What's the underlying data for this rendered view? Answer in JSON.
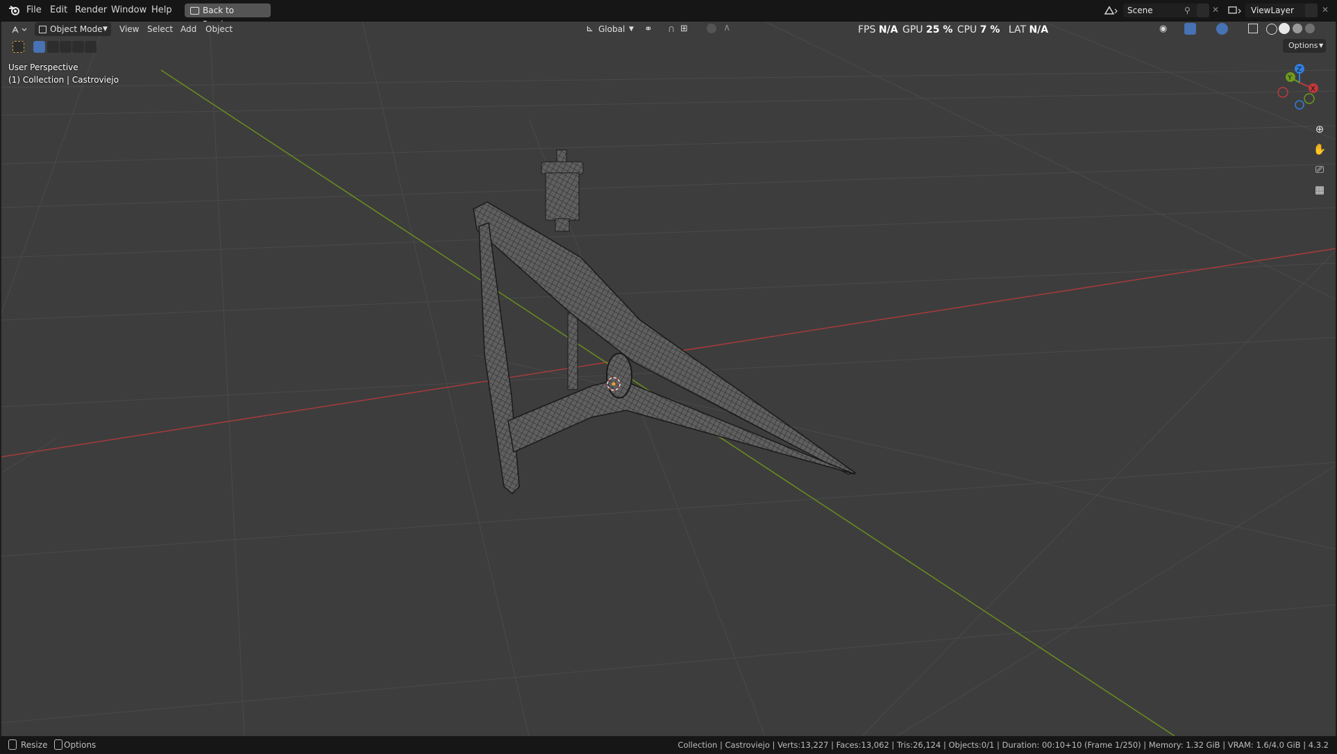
{
  "menu": [
    "File",
    "Edit",
    "Render",
    "Window",
    "Help"
  ],
  "back_button": "Back to Previous",
  "scene": {
    "label": "Scene",
    "view_layer": "ViewLayer"
  },
  "viewport_header": {
    "mode": "Object Mode",
    "menus": [
      "View",
      "Select",
      "Add",
      "Object"
    ],
    "orientation": "Global",
    "options": "Options"
  },
  "perf": {
    "fps_label": "FPS",
    "fps_value": "N/A",
    "gpu_label": "GPU",
    "gpu_value": "25 %",
    "cpu_label": "CPU",
    "cpu_value": "7 %",
    "lat_label": "LAT",
    "lat_value": "N/A"
  },
  "overlay": {
    "view_name": "User Perspective",
    "collection_line": "(1) Collection | Castroviejo"
  },
  "gizmo": {
    "z": "Z",
    "y": "Y",
    "x": "X"
  },
  "statusbar": {
    "left_1": "Resize",
    "left_2": "Options",
    "stats": "Collection | Castroviejo | Verts:13,227 | Faces:13,062 | Tris:26,124 | Objects:0/1 | Duration: 00:10+10 (Frame 1/250) | Memory: 1.32 GiB | VRAM: 1.6/4.0 GiB | 4.3.2"
  },
  "colors": {
    "viewport_bg": "#3d3d3d",
    "x_axis": "#c0393b",
    "y_axis": "#6e9a1e",
    "z_axis": "#2f7fe0",
    "accent_blue": "#4772b3"
  }
}
